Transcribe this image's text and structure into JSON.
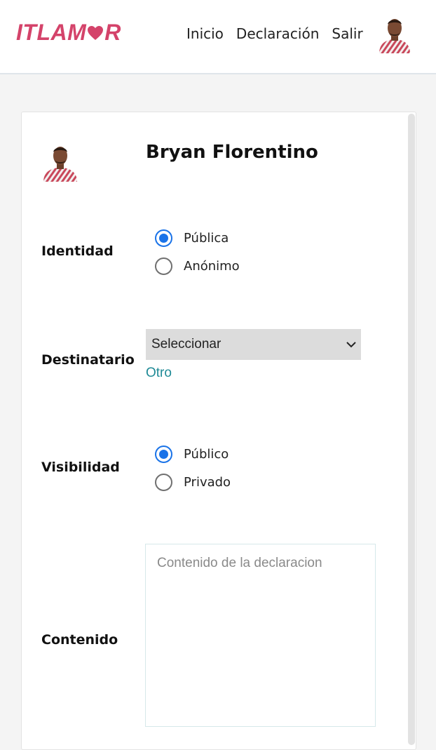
{
  "header": {
    "logo_prefix": "ITLAM",
    "logo_suffix": "R",
    "nav": [
      "Inicio",
      "Declaración",
      "Salir"
    ]
  },
  "profile": {
    "name": "Bryan Florentino"
  },
  "form": {
    "identity": {
      "label": "Identidad",
      "options": [
        "Pública",
        "Anónimo"
      ],
      "selected": "Pública"
    },
    "recipient": {
      "label": "Destinatario",
      "select_value": "Seleccionar",
      "other_link": "Otro"
    },
    "visibility": {
      "label": "Visibilidad",
      "options": [
        "Público",
        "Privado"
      ],
      "selected": "Público"
    },
    "content": {
      "label": "Contenido",
      "placeholder": "Contenido de la declaracion"
    }
  },
  "colors": {
    "brand": "#d4436a",
    "accent": "#1a73e8",
    "link": "#1f8a96"
  }
}
